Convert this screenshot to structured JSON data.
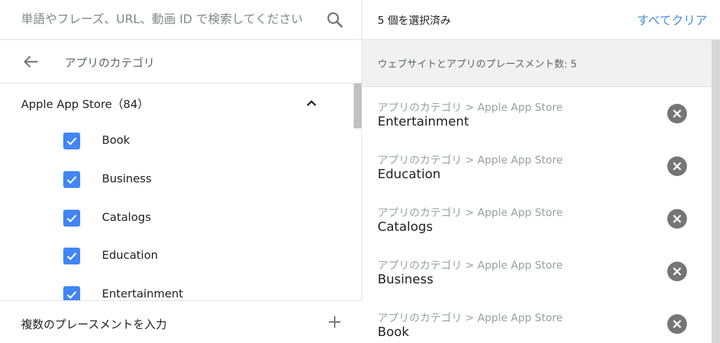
{
  "search": {
    "placeholder": "単語やフレーズ、URL、動画 ID で検索してください"
  },
  "nav": {
    "title": "アプリのカテゴリ"
  },
  "group": {
    "title": "Apple App Store（84）"
  },
  "categories": [
    {
      "label": "Book",
      "checked": true
    },
    {
      "label": "Business",
      "checked": true
    },
    {
      "label": "Catalogs",
      "checked": true
    },
    {
      "label": "Education",
      "checked": true
    },
    {
      "label": "Entertainment",
      "checked": true
    }
  ],
  "footer": {
    "label": "複数のプレースメントを入力"
  },
  "selected": {
    "count_label": "5 個を選択済み",
    "clear_label": "すべてクリア",
    "summary": "ウェブサイトとアプリのプレースメント数: 5",
    "items": [
      {
        "path": "アプリのカテゴリ > Apple App Store",
        "name": "Entertainment"
      },
      {
        "path": "アプリのカテゴリ > Apple App Store",
        "name": "Education"
      },
      {
        "path": "アプリのカテゴリ > Apple App Store",
        "name": "Catalogs"
      },
      {
        "path": "アプリのカテゴリ > Apple App Store",
        "name": "Business"
      },
      {
        "path": "アプリのカテゴリ > Apple App Store",
        "name": "Book"
      }
    ]
  },
  "icons": {
    "search": "search-icon",
    "back": "arrow-back-icon",
    "collapse": "chevron-up-icon",
    "check": "checkmark-icon",
    "add": "plus-icon",
    "remove": "close-circle-icon"
  },
  "colors": {
    "accent": "#4285f4",
    "link": "#4a90d9",
    "remove": "#757575"
  }
}
